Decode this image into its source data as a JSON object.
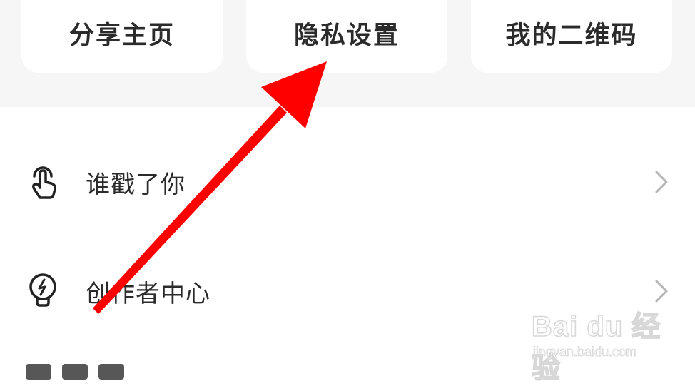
{
  "shortcut_cards": [
    {
      "label": "分享主页"
    },
    {
      "label": "隐私设置"
    },
    {
      "label": "我的二维码"
    }
  ],
  "menu": {
    "items": [
      {
        "label": "谁戳了你",
        "icon": "finger-tap-icon"
      },
      {
        "label": "创作者中心",
        "icon": "lightbulb-icon"
      }
    ]
  },
  "annotation": {
    "color": "#ff0000"
  },
  "watermark": {
    "logo": "Bai du 经验",
    "url": "jingyan.baidu.com"
  }
}
